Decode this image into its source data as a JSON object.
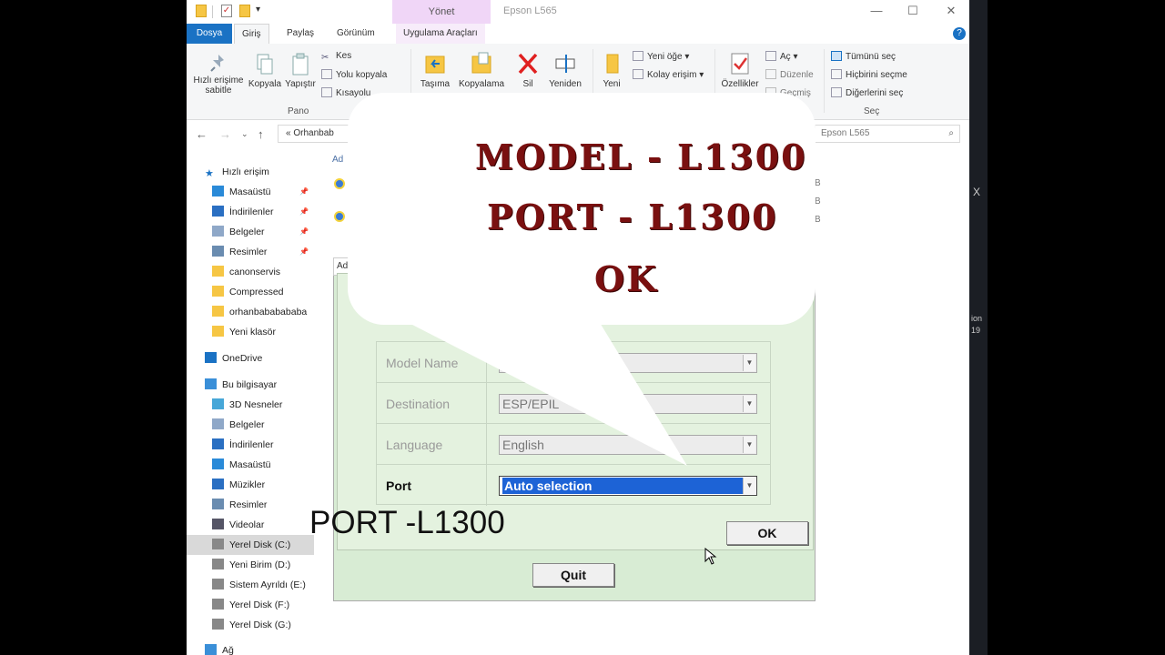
{
  "window": {
    "title": "Epson L565",
    "context_tab": "Yönet",
    "minimize": "—",
    "maximize": "☐",
    "close": "✕"
  },
  "ribbon_tabs": [
    "Dosya",
    "Giriş",
    "Paylaş",
    "Görünüm",
    "Uygulama Araçları"
  ],
  "ribbon": {
    "pin_label_1": "Hızlı erişime",
    "pin_label_2": "sabitle",
    "copy": "Kopyala",
    "paste": "Yapıştır",
    "cut": "Kes",
    "copy_path": "Yolu kopyala",
    "paste_shortcut": "Kısayolu",
    "group_clipboard": "Pano",
    "move": "Taşıma",
    "copy_to": "Kopyalama",
    "delete": "Sil",
    "rename": "Yeniden",
    "new": "Yeni",
    "new_item": "Yeni öğe ▾",
    "easy_access": "Kolay erişim ▾",
    "properties": "Özellikler",
    "open": "Aç ▾",
    "edit": "Düzenle",
    "history": "Geçmiş",
    "select_all": "Tümünü seç",
    "select_none": "Hiçbirini seçme",
    "invert_select": "Diğerlerini seç",
    "group_select": "Seç"
  },
  "address": {
    "path": "«   Orhanbab",
    "search_placeholder": "Epson L565"
  },
  "sidebar": [
    {
      "label": "Hızlı erişim",
      "icon": "star-icon",
      "indent": 0,
      "pin": false
    },
    {
      "label": "Masaüstü",
      "icon": "desktop-icon",
      "indent": 1,
      "pin": true
    },
    {
      "label": "İndirilenler",
      "icon": "download-icon",
      "indent": 1,
      "pin": true
    },
    {
      "label": "Belgeler",
      "icon": "document-icon",
      "indent": 1,
      "pin": true
    },
    {
      "label": "Resimler",
      "icon": "pictures-icon",
      "indent": 1,
      "pin": true
    },
    {
      "label": "canonservis",
      "icon": "folder-icon",
      "indent": 1,
      "pin": false
    },
    {
      "label": "Compressed",
      "icon": "folder-icon",
      "indent": 1,
      "pin": false
    },
    {
      "label": "orhanbababababa",
      "icon": "folder-icon",
      "indent": 1,
      "pin": false
    },
    {
      "label": "Yeni klasör",
      "icon": "folder-icon",
      "indent": 1,
      "pin": false
    },
    {
      "label": "OneDrive",
      "icon": "cloud-icon",
      "indent": 0,
      "pin": false
    },
    {
      "label": "Bu bilgisayar",
      "icon": "computer-icon",
      "indent": 0,
      "pin": false
    },
    {
      "label": "3D Nesneler",
      "icon": "cube-icon",
      "indent": 1,
      "pin": false
    },
    {
      "label": "Belgeler",
      "icon": "document-icon",
      "indent": 1,
      "pin": false
    },
    {
      "label": "İndirilenler",
      "icon": "download-icon",
      "indent": 1,
      "pin": false
    },
    {
      "label": "Masaüstü",
      "icon": "desktop-icon",
      "indent": 1,
      "pin": false
    },
    {
      "label": "Müzikler",
      "icon": "music-icon",
      "indent": 1,
      "pin": false
    },
    {
      "label": "Resimler",
      "icon": "pictures-icon",
      "indent": 1,
      "pin": false
    },
    {
      "label": "Videolar",
      "icon": "video-icon",
      "indent": 1,
      "pin": false
    },
    {
      "label": "Yerel Disk (C:)",
      "icon": "drive-icon",
      "indent": 1,
      "pin": false,
      "selected": true
    },
    {
      "label": "Yeni Birim (D:)",
      "icon": "drive-icon",
      "indent": 1,
      "pin": false
    },
    {
      "label": "Sistem Ayrıldı (E:)",
      "icon": "drive-icon",
      "indent": 1,
      "pin": false
    },
    {
      "label": "Yerel Disk (F:)",
      "icon": "drive-icon",
      "indent": 1,
      "pin": false
    },
    {
      "label": "Yerel Disk (G:)",
      "icon": "drive-icon",
      "indent": 1,
      "pin": false
    },
    {
      "label": "Ağ",
      "icon": "network-icon",
      "indent": 0,
      "pin": false
    }
  ],
  "file_list": {
    "column_name": "Ad",
    "size_suffix": "B"
  },
  "dialog": {
    "title_fragment": "Ad",
    "rows": [
      {
        "label": "Model Name",
        "value": "",
        "enabled": false
      },
      {
        "label": "Destination",
        "value": "ESP/EPIL",
        "enabled": false
      },
      {
        "label": "Language",
        "value": "English",
        "enabled": false
      },
      {
        "label": "Port",
        "value": "Auto selection",
        "enabled": true
      }
    ],
    "ok_button": "OK",
    "quit_button": "Quit"
  },
  "overlay": {
    "line1": "MODEL - L1300",
    "line2": "PORT - L1300",
    "line3": "OK",
    "caption": "PORT -L1300"
  },
  "side_strip": {
    "x_text": "X",
    "t1": "ion",
    "t2": "19"
  },
  "colors": {
    "accent": "#1a72c4",
    "overlay_text": "#7a1010",
    "dialog_bg": "#e4f2df",
    "selection": "#1d63d6"
  }
}
